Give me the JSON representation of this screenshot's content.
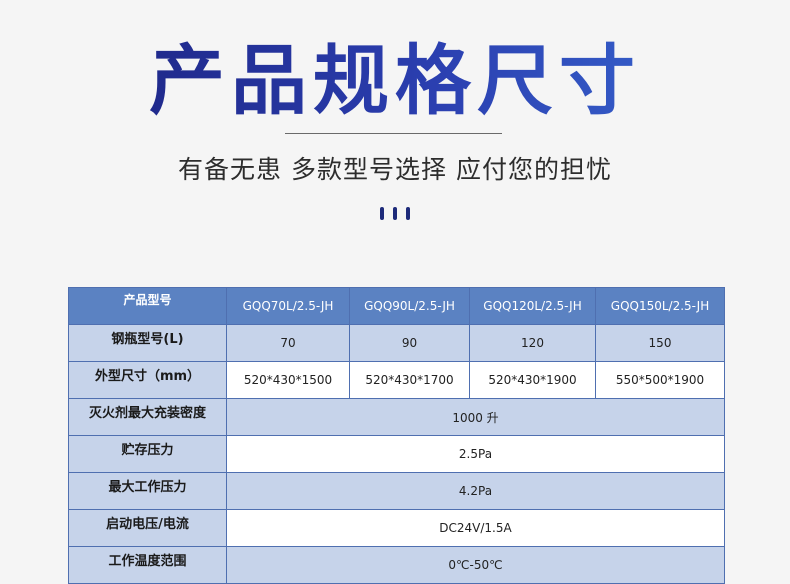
{
  "header": {
    "title": "产品规格尺寸",
    "subtitle": "有备无患 多款型号选择 应付您的担忧"
  },
  "table": {
    "model_label": "产品型号",
    "models": [
      "GQQ70L/2.5-JH",
      "GQQ90L/2.5-JH",
      "GQQ120L/2.5-JH",
      "GQQ150L/2.5-JH"
    ],
    "bottle_label": "钢瓶型号(L)",
    "bottles": [
      "70",
      "90",
      "120",
      "150"
    ],
    "size_label": "外型尺寸（mm）",
    "sizes": [
      "520*430*1500",
      "520*430*1700",
      "520*430*1900",
      "550*500*1900"
    ],
    "density_label": "灭火剂最大充装密度",
    "density_value": "1000 升",
    "storage_label": "贮存压力",
    "storage_value": "2.5Pa",
    "working_label": "最大工作压力",
    "working_value": "4.2Pa",
    "start_label": "启动电压/电流",
    "start_value": "DC24V/1.5A",
    "temp_label": "工作温度范围",
    "temp_value": "0℃-50℃"
  },
  "colors": {
    "title_gradient": [
      "#1a1f7a",
      "#3a6ed6"
    ],
    "header_row": "#5b82c2",
    "alt_row": "#c6d3ea",
    "border": "#4f6fb0"
  }
}
